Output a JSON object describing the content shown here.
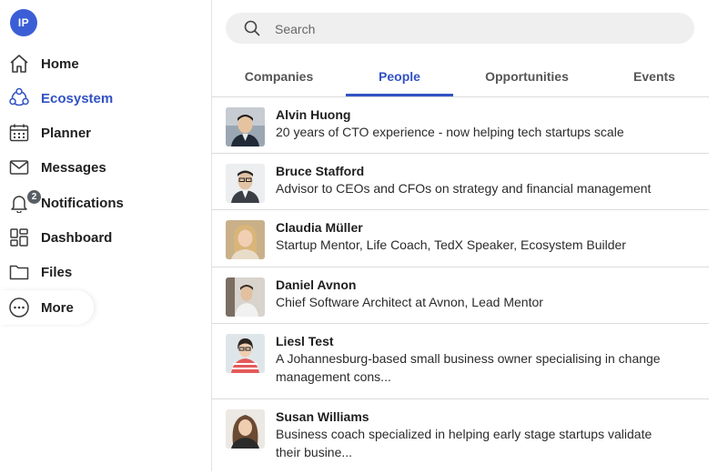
{
  "user": {
    "initials": "IP"
  },
  "sidebar": {
    "items": [
      {
        "label": "Home",
        "icon": "home-icon"
      },
      {
        "label": "Ecosystem",
        "icon": "ecosystem-icon",
        "active": true
      },
      {
        "label": "Planner",
        "icon": "calendar-icon"
      },
      {
        "label": "Messages",
        "icon": "envelope-icon"
      },
      {
        "label": "Notifications",
        "icon": "bell-icon",
        "badge": "2"
      },
      {
        "label": "Dashboard",
        "icon": "dashboard-icon"
      },
      {
        "label": "Files",
        "icon": "folder-icon"
      },
      {
        "label": "More",
        "icon": "more-icon"
      }
    ]
  },
  "search": {
    "placeholder": "Search",
    "value": ""
  },
  "tabs": [
    {
      "label": "Companies"
    },
    {
      "label": "People",
      "active": true
    },
    {
      "label": "Opportunities"
    },
    {
      "label": "Events"
    }
  ],
  "people": [
    {
      "name": "Alvin Huong",
      "desc": "20 years of CTO experience - now helping tech startups scale"
    },
    {
      "name": "Bruce Stafford",
      "desc": "Advisor to CEOs and CFOs on strategy and financial management"
    },
    {
      "name": "Claudia Müller",
      "desc": "Startup Mentor, Life Coach, TedX Speaker, Ecosystem Builder"
    },
    {
      "name": "Daniel Avnon",
      "desc": "Chief Software Architect at Avnon, Lead Mentor"
    },
    {
      "name": "Liesl Test",
      "desc": "A Johannesburg-based small business owner specialising in change management cons..."
    },
    {
      "name": "Susan Williams",
      "desc": "Business coach specialized in helping early stage startups validate their busine..."
    }
  ],
  "colors": {
    "accent": "#3152c4",
    "avatar": "#3b5ed6"
  }
}
